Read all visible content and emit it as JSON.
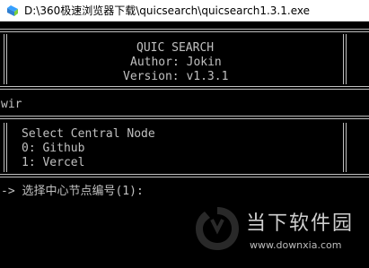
{
  "window": {
    "title": "D:\\360极速浏览器下载\\quicsearch\\quicsearch1.3.1.exe",
    "icon": "app-folder-icon"
  },
  "console": {
    "banner_lines": [
      "QUIC SEARCH",
      "Author: Jokin",
      "Version: v1.3.1"
    ],
    "input_echo": "wir",
    "menu_title": "Select Central Node",
    "menu_options": [
      "0: Github",
      "1: Vercel"
    ],
    "prompt": "-> 选择中心节点编号(1):"
  },
  "watermark": {
    "site_name": "当下软件园",
    "url": "www.downxia.com"
  },
  "colors": {
    "console_bg": "#000000",
    "console_text": "#c0c0c0",
    "titlebar_bg": "#ffffff"
  }
}
